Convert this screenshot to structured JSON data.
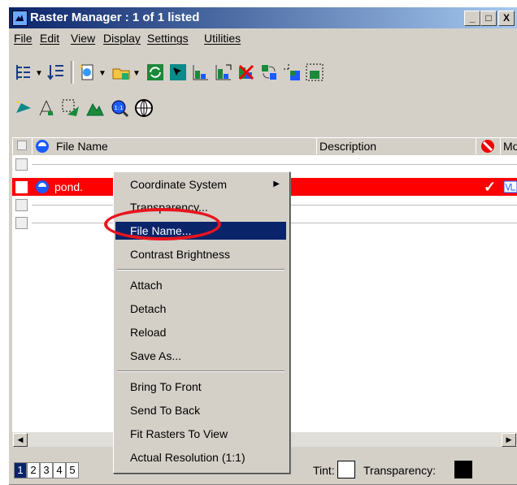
{
  "window": {
    "title": "Raster Manager : 1 of 1 listed"
  },
  "title_buttons": {
    "minimize": "_",
    "maximize": "□",
    "close": "X"
  },
  "menu": [
    "File",
    "Edit",
    "View",
    "Display",
    "Settings",
    "Utilities"
  ],
  "toolbar_row1": [
    "tree-view-icon",
    "list-view-icon",
    "new-raster-icon",
    "open-folder-icon",
    "refresh-icon",
    "select-icon",
    "graph-icon",
    "graph-export-icon",
    "remove-icon",
    "swap-icon",
    "move-grid-icon",
    "fit-grid-icon"
  ],
  "toolbar_row2": [
    "attach-icon",
    "tilt-icon",
    "edit-raster-icon",
    "terrain-icon",
    "zoom-1to1-icon",
    "globe-icon"
  ],
  "columns": {
    "file_name": "File Name",
    "description": "Description",
    "mo": "Mo"
  },
  "rows": [
    {
      "name": "",
      "selected": false
    },
    {
      "name": "pond.",
      "selected": true,
      "check": "✓"
    },
    {
      "name": "",
      "selected": false
    },
    {
      "name": "",
      "selected": false
    }
  ],
  "context_menu": [
    {
      "label": "Coordinate System",
      "submenu": true
    },
    {
      "label": "Transparency..."
    },
    {
      "label": "File Name...",
      "highlighted": true
    },
    {
      "label": "Contrast Brightness"
    },
    {
      "label": "Attach"
    },
    {
      "label": "Detach"
    },
    {
      "label": "Reload"
    },
    {
      "label": "Save As..."
    },
    {
      "label": "Bring To Front"
    },
    {
      "label": "Send To Back"
    },
    {
      "label": "Fit Rasters To View"
    },
    {
      "label": "Actual Resolution (1:1)"
    }
  ],
  "status": {
    "pages": [
      "1",
      "2",
      "3",
      "4",
      "5"
    ],
    "selected_page": "1",
    "tint_label": "Tint:",
    "transparency_label": "Transparency:",
    "tint_color": "#ffffff",
    "transparency_color": "#000000"
  },
  "colors": {
    "selection": "#ff0000",
    "highlight": "#0a246a",
    "annotation": "#e8141e"
  }
}
